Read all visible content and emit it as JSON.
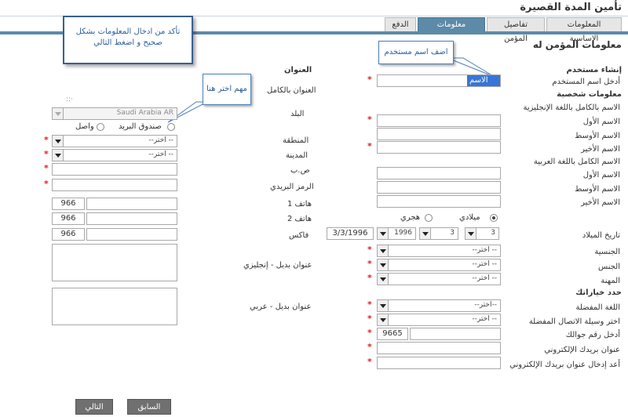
{
  "page_title": "تأمين المدة القصيرة",
  "tabs": [
    {
      "label": "المعلومات الاساسية",
      "active": false
    },
    {
      "label": "تفاصيل المؤمن",
      "active": false
    },
    {
      "label": "معلومات شخصية",
      "active": true
    },
    {
      "label": "الدفع",
      "active": false
    }
  ],
  "section_title": "معلومات المؤمن له",
  "callouts": {
    "username_tip": "اضف اسم مستخدم",
    "important_tip": "مهم اختر هنا",
    "info_tip_line1": "تأكد من ادخال المعلومات بشكل",
    "info_tip_line2": "صحيح و اضغط التالي"
  },
  "create_user": {
    "heading": "إنشاء مستخدم",
    "username_label": "أدخل اسم المستخدم",
    "username_value": "الاسم"
  },
  "personal": {
    "heading": "معلومات شخصية",
    "full_name_en_label": "الاسم بالكامل باللغة الإنجليزية",
    "first_name_label": "الاسم الأول",
    "middle_name_label": "الاسم الأوسط",
    "last_name_label": "الاسم الأخير",
    "full_name_ar_label": "الاسم الكامل باللغة العربية",
    "first_name_ar_label": "الاسم الأول",
    "middle_name_ar_label": "الاسم الأوسط",
    "last_name_ar_label": "الاسم الأخير"
  },
  "birth": {
    "label": "تاريخ الميلاد",
    "gregorian": "ميلادي",
    "hijri": "هجري",
    "day": "3",
    "month": "3",
    "year": "1996",
    "date_text": "3/3/1996"
  },
  "selects": {
    "nationality_label": "الجنسية",
    "gender_label": "الجنس",
    "occupation_label": "المهنة",
    "choose": "-- اختر--",
    "choose_plain": "--اختر--"
  },
  "preferences": {
    "heading": "حدد خياراتك",
    "language_label": "اللغة المفضلة",
    "contact_label": "اختر وسيلة الاتصال المفضلة",
    "mobile_label": "أدخل رقم جوالك",
    "mobile_code": "9665",
    "email_label": "عنوان بريدك الإلكتروني",
    "email_confirm_label": "أعد إدخال عنوان بريدك الإلكتروني"
  },
  "address": {
    "heading": "العنوان",
    "full_address_label": "العنوان بالكامل",
    "country_label": "البلد",
    "country_value": "Saudi Arabia AR",
    "po_box_option": "صندوق البريد",
    "wasel_option": "واصل",
    "region_label": "المنطقة",
    "city_label": "المدينة",
    "pobox_label": "ص.ب",
    "postal_label": "الرمز البريدي",
    "phone1_label": "هاتف 1",
    "phone2_label": "هاتف 2",
    "fax_label": "فاكس",
    "country_code": "966",
    "alt_en_label": "عنوان بديل - إنجليزي",
    "alt_ar_label": "عنوان بديل - عربي",
    "choose": "-- اختر--"
  },
  "buttons": {
    "prev": "السابق",
    "next": "التالي"
  },
  "colors": {
    "tab_active": "#5c8aa8",
    "required": "#e02020",
    "callout_border": "#4a7ebb"
  }
}
